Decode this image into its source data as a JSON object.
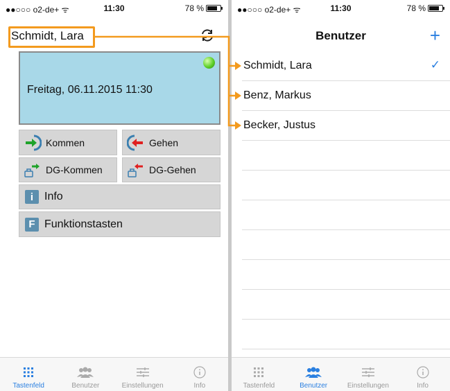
{
  "status_bar": {
    "carrier": "●●○○○ o2-de+ ᯤ",
    "time": "11:30",
    "battery": "78 %",
    "battery_level": 0.78
  },
  "left": {
    "user_name": "Schmidt, Lara",
    "display_datetime": "Freitag, 06.11.2015 11:30",
    "buttons": {
      "kommen": "Kommen",
      "gehen": "Gehen",
      "dg_kommen": "DG-Kommen",
      "dg_gehen": "DG-Gehen",
      "info": "Info",
      "info_letter": "i",
      "funktionstasten": "Funktionstasten",
      "funktionstasten_letter": "F"
    }
  },
  "right": {
    "title": "Benutzer",
    "add_label": "+",
    "users": [
      {
        "name": "Schmidt, Lara",
        "selected": true
      },
      {
        "name": "Benz, Markus",
        "selected": false
      },
      {
        "name": "Becker, Justus",
        "selected": false
      }
    ]
  },
  "tabs": [
    {
      "label": "Tastenfeld",
      "icon": "keypad-icon"
    },
    {
      "label": "Benutzer",
      "icon": "users-icon"
    },
    {
      "label": "Einstellungen",
      "icon": "sliders-icon"
    },
    {
      "label": "Info",
      "icon": "info-icon"
    }
  ],
  "colors": {
    "accent": "#2a7fe0",
    "callout": "#f39a1e",
    "display": "#a8d8e8",
    "led": "#5fd02a"
  }
}
